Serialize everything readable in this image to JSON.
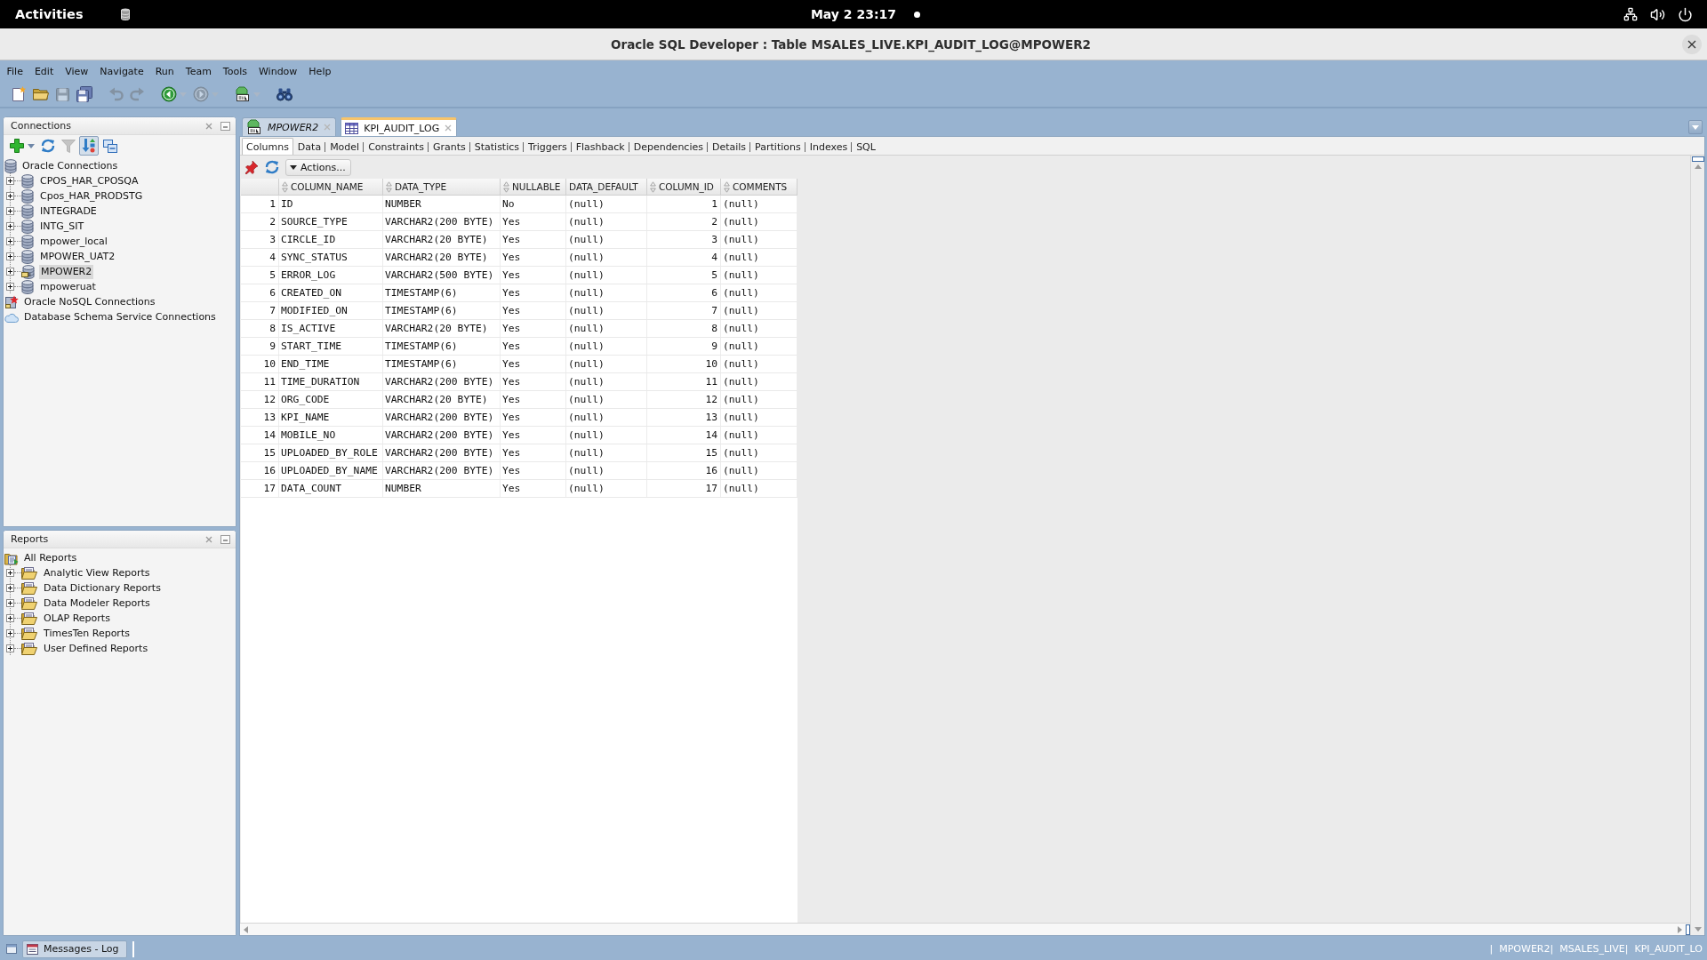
{
  "top_bar": {
    "activities": "Activities",
    "clock": "May 2 23:17"
  },
  "window": {
    "title": "Oracle SQL Developer : Table MSALES_LIVE.KPI_AUDIT_LOG@MPOWER2"
  },
  "menu": [
    "File",
    "Edit",
    "View",
    "Navigate",
    "Run",
    "Team",
    "Tools",
    "Window",
    "Help"
  ],
  "toolbar": [
    {
      "disabled": false
    },
    {
      "disabled": false
    },
    {
      "disabled": true
    },
    {
      "disabled": false
    },
    {
      "disabled": true
    },
    {
      "disabled": true
    },
    {
      "disabled": false
    },
    {
      "disabled": true
    },
    {
      "disabled": false
    },
    {
      "disabled": false
    }
  ],
  "connections": {
    "title": "Connections",
    "toolbar": [
      {
        "disabled": false,
        "on": false
      },
      {
        "disabled": false,
        "on": false
      },
      {
        "disabled": true,
        "on": false
      },
      {
        "disabled": false,
        "on": true
      },
      {
        "disabled": false,
        "on": false
      }
    ],
    "tree": [
      {
        "label": "Oracle Connections",
        "kind": "database",
        "selected": false,
        "children": [
          {
            "label": "CPOS_HAR_CPOSQA",
            "kind": "database",
            "expanded": false,
            "selected": false
          },
          {
            "label": "Cpos_HAR_PRODSTG",
            "kind": "database",
            "expanded": false,
            "selected": false
          },
          {
            "label": "INTEGRADE",
            "kind": "database",
            "expanded": false,
            "selected": false
          },
          {
            "label": "INTG_SIT",
            "kind": "database",
            "expanded": false,
            "selected": false
          },
          {
            "label": "mpower_local",
            "kind": "database",
            "expanded": false,
            "selected": false
          },
          {
            "label": "MPOWER_UAT2",
            "kind": "database",
            "expanded": false,
            "selected": false
          },
          {
            "label": "MPOWER2",
            "kind": "connected",
            "expanded": false,
            "selected": true
          },
          {
            "label": "mpoweruat",
            "kind": "database",
            "expanded": false,
            "selected": false
          }
        ]
      },
      {
        "label": "Oracle NoSQL Connections",
        "kind": "nosql",
        "selected": false
      },
      {
        "label": "Database Schema Service Connections",
        "kind": "cloud",
        "selected": false
      }
    ]
  },
  "reports": {
    "title": "Reports",
    "tree": [
      {
        "label": "All Reports",
        "kind": "report_root",
        "selected": false,
        "children": [
          {
            "label": "Analytic View Reports",
            "kind": "folder",
            "expanded": false,
            "selected": false
          },
          {
            "label": "Data Dictionary Reports",
            "kind": "folder",
            "expanded": false,
            "selected": false
          },
          {
            "label": "Data Modeler Reports",
            "kind": "folder",
            "expanded": false,
            "selected": false
          },
          {
            "label": "OLAP Reports",
            "kind": "folder",
            "expanded": false,
            "selected": false
          },
          {
            "label": "TimesTen Reports",
            "kind": "folder",
            "expanded": false,
            "selected": false
          },
          {
            "label": "User Defined Reports",
            "kind": "folder",
            "expanded": false,
            "selected": false
          }
        ]
      }
    ]
  },
  "document_tabs": [
    {
      "label": "MPOWER2",
      "kind": "worksheet",
      "selected": false
    },
    {
      "label": "KPI_AUDIT_LOG",
      "kind": "table",
      "selected": true
    }
  ],
  "subtabs": [
    {
      "label": "Columns",
      "selected": true
    },
    {
      "label": "Data",
      "selected": false
    },
    {
      "label": "Model",
      "selected": false
    },
    {
      "label": "Constraints",
      "selected": false
    },
    {
      "label": "Grants",
      "selected": false
    },
    {
      "label": "Statistics",
      "selected": false
    },
    {
      "label": "Triggers",
      "selected": false
    },
    {
      "label": "Flashback",
      "selected": false
    },
    {
      "label": "Dependencies",
      "selected": false
    },
    {
      "label": "Details",
      "selected": false
    },
    {
      "label": "Partitions",
      "selected": false
    },
    {
      "label": "Indexes",
      "selected": false
    },
    {
      "label": "SQL",
      "selected": false
    }
  ],
  "actions_button": "Actions...",
  "table": {
    "columns": [
      {
        "label": "COLUMN_NAME",
        "sortable": true
      },
      {
        "label": "DATA_TYPE",
        "sortable": true
      },
      {
        "label": "NULLABLE",
        "sortable": true
      },
      {
        "label": "DATA_DEFAULT",
        "sortable": false
      },
      {
        "label": "COLUMN_ID",
        "sortable": true
      },
      {
        "label": "COMMENTS",
        "sortable": true
      }
    ],
    "rows": [
      {
        "number": "1",
        "cells": [
          "ID",
          "NUMBER",
          "No",
          "(null)",
          "1",
          "(null)"
        ]
      },
      {
        "number": "2",
        "cells": [
          "SOURCE_TYPE",
          "VARCHAR2(200 BYTE)",
          "Yes",
          "(null)",
          "2",
          "(null)"
        ]
      },
      {
        "number": "3",
        "cells": [
          "CIRCLE_ID",
          "VARCHAR2(20 BYTE)",
          "Yes",
          "(null)",
          "3",
          "(null)"
        ]
      },
      {
        "number": "4",
        "cells": [
          "SYNC_STATUS",
          "VARCHAR2(20 BYTE)",
          "Yes",
          "(null)",
          "4",
          "(null)"
        ]
      },
      {
        "number": "5",
        "cells": [
          "ERROR_LOG",
          "VARCHAR2(500 BYTE)",
          "Yes",
          "(null)",
          "5",
          "(null)"
        ]
      },
      {
        "number": "6",
        "cells": [
          "CREATED_ON",
          "TIMESTAMP(6)",
          "Yes",
          "(null)",
          "6",
          "(null)"
        ]
      },
      {
        "number": "7",
        "cells": [
          "MODIFIED_ON",
          "TIMESTAMP(6)",
          "Yes",
          "(null)",
          "7",
          "(null)"
        ]
      },
      {
        "number": "8",
        "cells": [
          "IS_ACTIVE",
          "VARCHAR2(20 BYTE)",
          "Yes",
          "(null)",
          "8",
          "(null)"
        ]
      },
      {
        "number": "9",
        "cells": [
          "START_TIME",
          "TIMESTAMP(6)",
          "Yes",
          "(null)",
          "9",
          "(null)"
        ]
      },
      {
        "number": "10",
        "cells": [
          "END_TIME",
          "TIMESTAMP(6)",
          "Yes",
          "(null)",
          "10",
          "(null)"
        ]
      },
      {
        "number": "11",
        "cells": [
          "TIME_DURATION",
          "VARCHAR2(200 BYTE)",
          "Yes",
          "(null)",
          "11",
          "(null)"
        ]
      },
      {
        "number": "12",
        "cells": [
          "ORG_CODE",
          "VARCHAR2(20 BYTE)",
          "Yes",
          "(null)",
          "12",
          "(null)"
        ]
      },
      {
        "number": "13",
        "cells": [
          "KPI_NAME",
          "VARCHAR2(200 BYTE)",
          "Yes",
          "(null)",
          "13",
          "(null)"
        ]
      },
      {
        "number": "14",
        "cells": [
          "MOBILE_NO",
          "VARCHAR2(200 BYTE)",
          "Yes",
          "(null)",
          "14",
          "(null)"
        ]
      },
      {
        "number": "15",
        "cells": [
          "UPLOADED_BY_ROLE",
          "VARCHAR2(200 BYTE)",
          "Yes",
          "(null)",
          "15",
          "(null)"
        ]
      },
      {
        "number": "16",
        "cells": [
          "UPLOADED_BY_NAME",
          "VARCHAR2(200 BYTE)",
          "Yes",
          "(null)",
          "16",
          "(null)"
        ]
      },
      {
        "number": "17",
        "cells": [
          "DATA_COUNT",
          "NUMBER",
          "Yes",
          "(null)",
          "17",
          "(null)"
        ]
      }
    ]
  },
  "status_bar": {
    "messages_tab": "Messages - Log",
    "context": "|  MPOWER2|  MSALES_LIVE|  KPI_AUDIT_LO"
  }
}
